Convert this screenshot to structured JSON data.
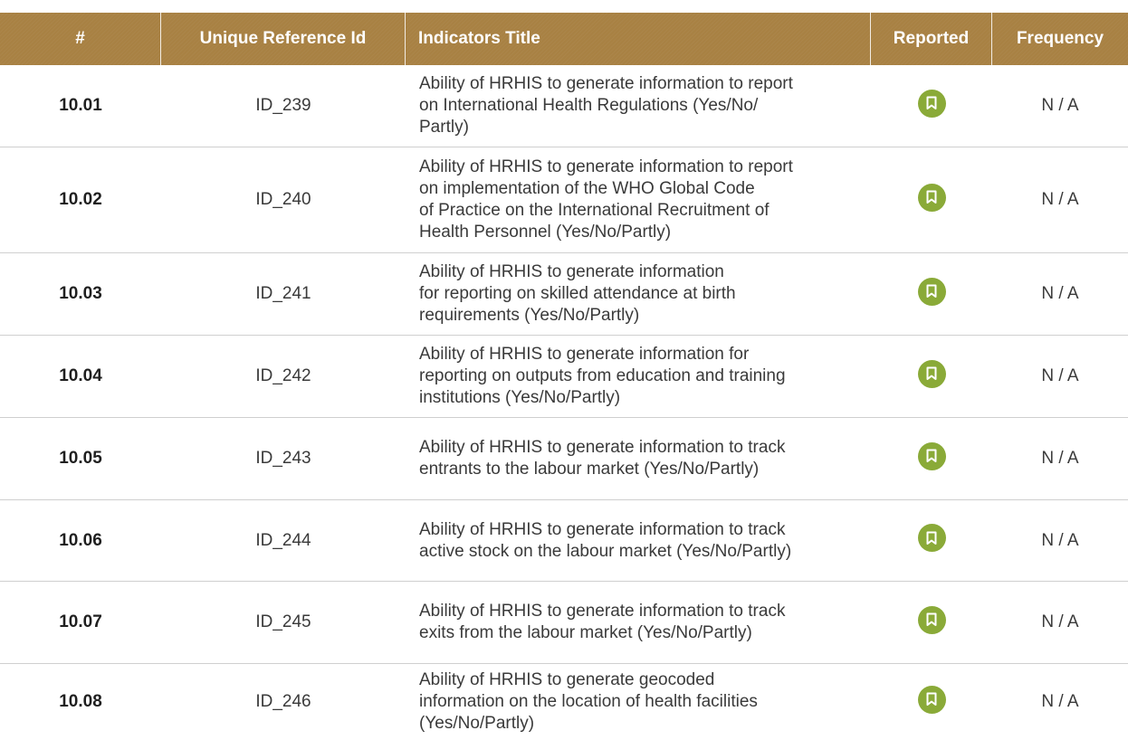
{
  "table": {
    "headers": {
      "num": "#",
      "ref": "Unique Reference Id",
      "title": "Indicators Title",
      "reported": "Reported",
      "frequency": "Frequency"
    },
    "rows": [
      {
        "num": "10.01",
        "ref": "ID_239",
        "title_lines": [
          "Ability of HRHIS to generate information to report",
          "on International Health Regulations (Yes/No/",
          "Partly)"
        ],
        "reported_icon": "bookmark-icon",
        "frequency": "N / A"
      },
      {
        "num": "10.02",
        "ref": "ID_240",
        "title_lines": [
          "Ability of HRHIS to generate information to report",
          "on implementation of the WHO Global Code",
          "of Practice on the International Recruitment of",
          "Health Personnel (Yes/No/Partly)"
        ],
        "reported_icon": "bookmark-icon",
        "frequency": "N / A"
      },
      {
        "num": "10.03",
        "ref": "ID_241",
        "title_lines": [
          "Ability of HRHIS to generate information",
          "for reporting on skilled attendance at birth",
          "requirements (Yes/No/Partly)"
        ],
        "reported_icon": "bookmark-icon",
        "frequency": "N / A"
      },
      {
        "num": "10.04",
        "ref": "ID_242",
        "title_lines": [
          "Ability of HRHIS to generate information for",
          "reporting on outputs from education and training",
          "institutions (Yes/No/Partly)"
        ],
        "reported_icon": "bookmark-icon",
        "frequency": "N / A"
      },
      {
        "num": "10.05",
        "ref": "ID_243",
        "title_lines": [
          "Ability of HRHIS to generate information to track",
          "entrants to the labour market (Yes/No/Partly)"
        ],
        "reported_icon": "bookmark-icon",
        "frequency": "N / A"
      },
      {
        "num": "10.06",
        "ref": "ID_244",
        "title_lines": [
          "Ability of HRHIS to generate information to track",
          "active stock on the labour market (Yes/No/Partly)"
        ],
        "reported_icon": "bookmark-icon",
        "frequency": "N / A"
      },
      {
        "num": "10.07",
        "ref": "ID_245",
        "title_lines": [
          "Ability of HRHIS to generate information to track",
          "exits from the labour market (Yes/No/Partly)"
        ],
        "reported_icon": "bookmark-icon",
        "frequency": "N / A"
      },
      {
        "num": "10.08",
        "ref": "ID_246",
        "title_lines": [
          "Ability of HRHIS to generate geocoded",
          "information on the location of health facilities",
          "(Yes/No/Partly)"
        ],
        "reported_icon": "bookmark-icon",
        "frequency": "N / A"
      }
    ]
  },
  "colors": {
    "header_bg": "#a88143",
    "badge_green": "#8aaa38",
    "row_divider": "#cfcfcf"
  }
}
